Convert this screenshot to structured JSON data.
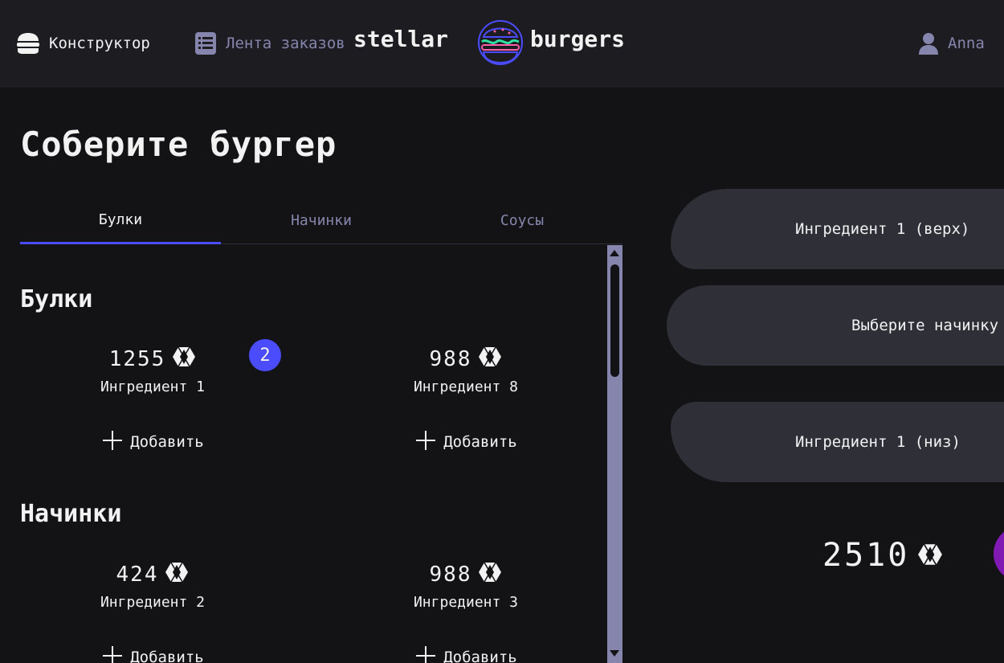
{
  "header": {
    "nav_constructor": "Конструктор",
    "nav_feed": "Лента заказов",
    "logo_left": "stellar",
    "logo_right": "burgers",
    "profile_name": "Anna"
  },
  "page_title": "Соберите бургер",
  "tabs": [
    {
      "label": "Булки",
      "active": true
    },
    {
      "label": "Начинки",
      "active": false
    },
    {
      "label": "Соусы",
      "active": false
    }
  ],
  "sections": {
    "buns": {
      "title": "Булки",
      "items": [
        {
          "price": "1255",
          "name": "Ингредиент 1",
          "add": "Добавить",
          "count": "2"
        },
        {
          "price": "988",
          "name": "Ингредиент 8",
          "add": "Добавить"
        }
      ]
    },
    "fillings": {
      "title": "Начинки",
      "items": [
        {
          "price": "424",
          "name": "Ингредиент 2",
          "add": "Добавить"
        },
        {
          "price": "988",
          "name": "Ингредиент 3",
          "add": "Добавить"
        }
      ]
    }
  },
  "constructor": {
    "top": "Ингредиент 1 (верх)",
    "middle": "Выберите начинку",
    "bottom": "Ингредиент 1 (низ)",
    "total": "2510"
  },
  "colors": {
    "background": "#131316",
    "header": "#1c1c21",
    "accent": "#4c4cff",
    "inactive": "#8585ad",
    "slot": "#2f2f37",
    "order_button": "#801ab2"
  },
  "icons": {
    "constructor": "burger-icon",
    "feed": "list-icon",
    "profile": "profile-icon",
    "currency": "currency-crystal-icon",
    "add": "plus-icon"
  }
}
